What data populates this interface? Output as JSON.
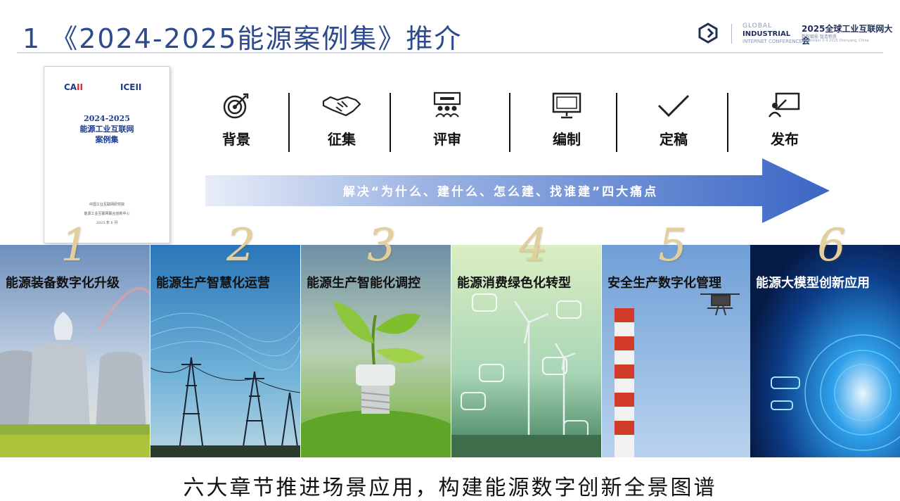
{
  "title": "1 《2024-2025能源案例集》推介",
  "header_logo": {
    "en_line1": "GLOBAL",
    "en_line2": "INDUSTRIAL",
    "en_line3": "INTERNET CONFERENCE",
    "cn_title": "2025全球工业互联网大会",
    "sub1": "数智赋能 智造新质",
    "sub2": "September 2-4 2025 Shenyang, China"
  },
  "cover": {
    "logo_left_a": "CA",
    "logo_left_b": "II",
    "logo_right": "ICEII",
    "title_line1": "2024-2025",
    "title_line2": "能源工业互联网",
    "title_line3": "案例集",
    "foot_line1": "中国工业互联网研究院",
    "foot_line2": "能源工业互联网联合创新中心",
    "foot_line3": "2025 年 6 月"
  },
  "steps": [
    {
      "label": "背景",
      "icon": "target-icon"
    },
    {
      "label": "征集",
      "icon": "handshake-icon"
    },
    {
      "label": "评审",
      "icon": "meeting-icon"
    },
    {
      "label": "编制",
      "icon": "monitor-icon"
    },
    {
      "label": "定稿",
      "icon": "checkmark-icon"
    },
    {
      "label": "发布",
      "icon": "presentation-icon"
    }
  ],
  "arrow_text": "解决“为什么、建什么、怎么建、找谁建”四大痛点",
  "chapters": [
    {
      "num": "1",
      "title": "能源装备数字化升级"
    },
    {
      "num": "2",
      "title": "能源生产智慧化运营"
    },
    {
      "num": "3",
      "title": "能源生产智能化调控"
    },
    {
      "num": "4",
      "title": "能源消费绿色化转型"
    },
    {
      "num": "5",
      "title": "安全生产数字化管理"
    },
    {
      "num": "6",
      "title": "能源大模型创新应用"
    }
  ],
  "bottom_text": "六大章节推进场景应用，构建能源数字创新全景图谱",
  "colors": {
    "title": "#2c4a8c",
    "arrow_start": "#e6ebf6",
    "arrow_end": "#3a66c4"
  }
}
